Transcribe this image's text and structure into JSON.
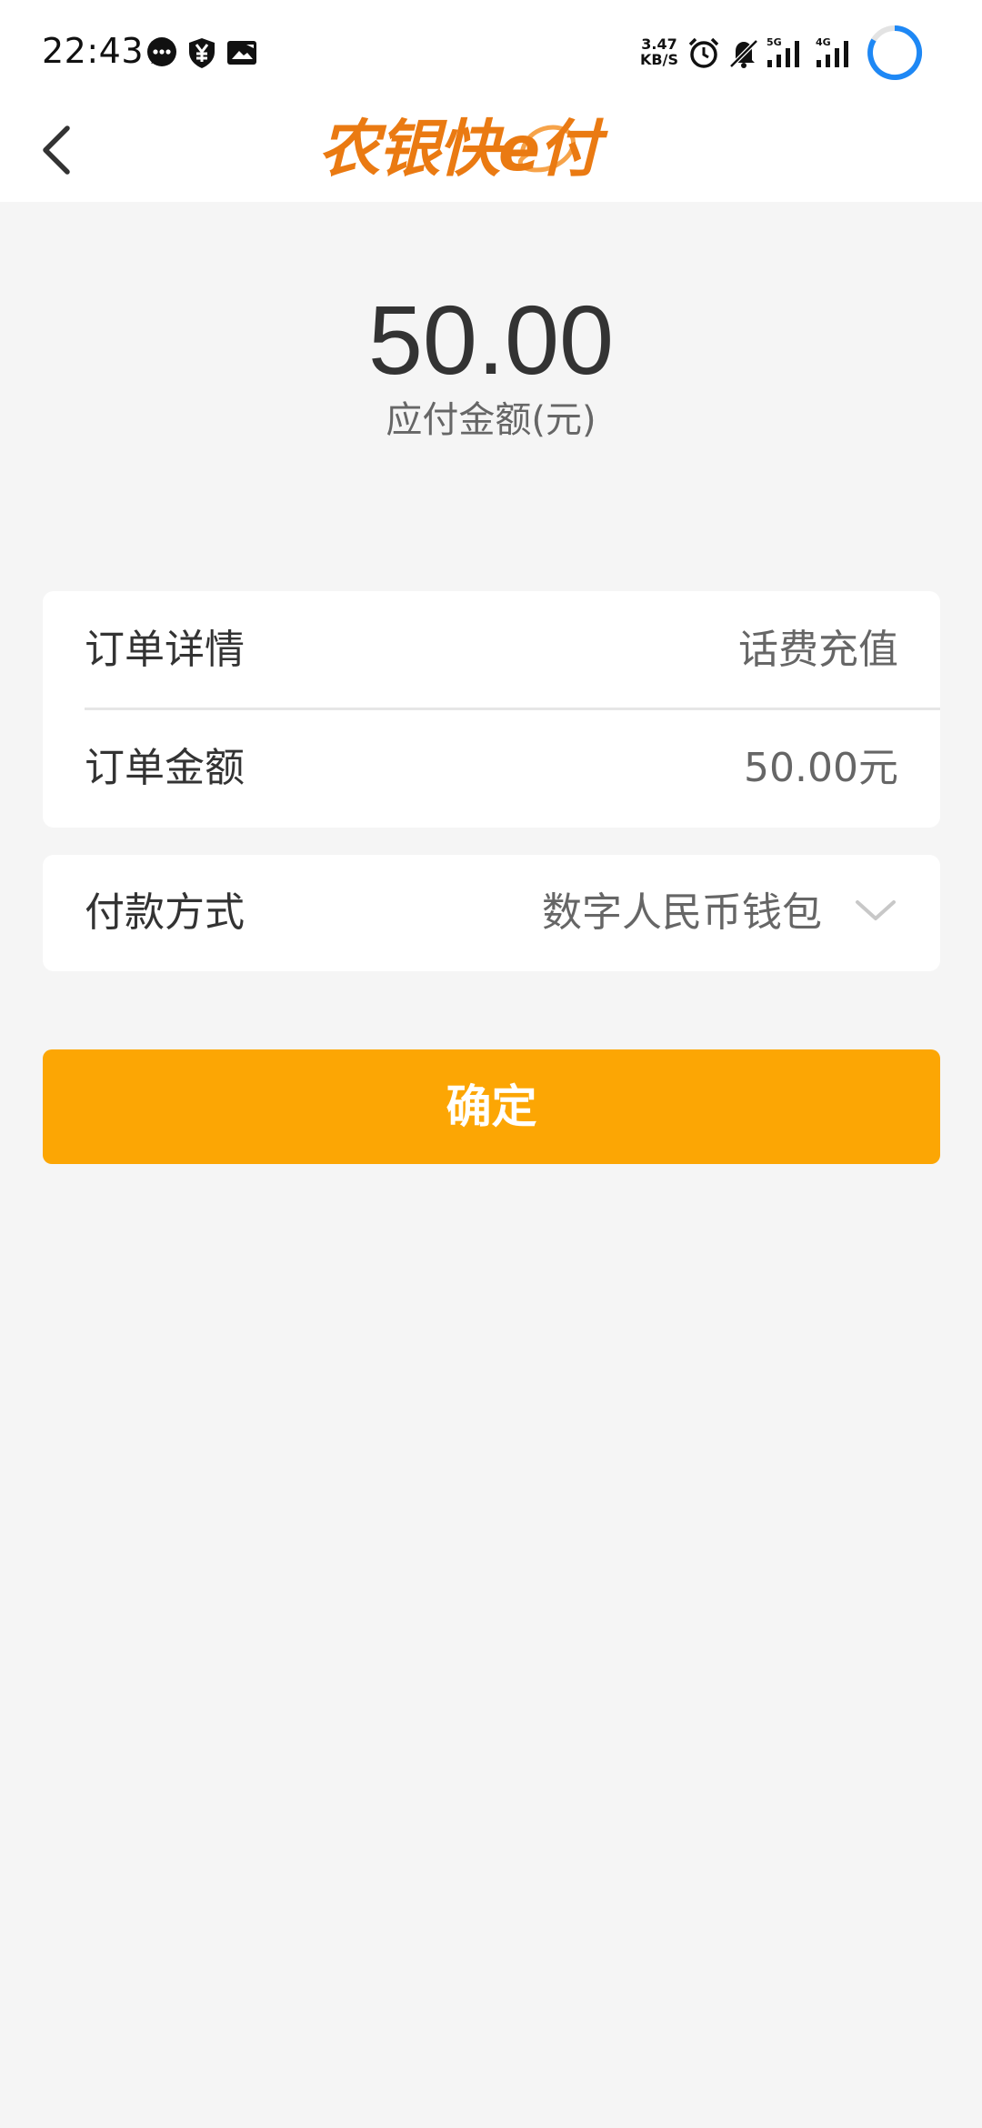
{
  "status_bar": {
    "time": "22:43",
    "net_speed_value": "3.47",
    "net_speed_unit": "KB/S",
    "signal_5g_label": "5G",
    "signal_4g_label": "4G",
    "icons": [
      "message-bubble-icon",
      "yuan-shield-icon",
      "image-notification-icon",
      "alarm-clock-icon",
      "mute-bell-icon",
      "signal-5g-icon",
      "signal-4g-icon",
      "loading-ring-icon"
    ]
  },
  "header": {
    "logo_text": "农银快e付",
    "back_icon": "chevron-left-icon"
  },
  "payment": {
    "amount": "50.00",
    "amount_label": "应付金额(元)"
  },
  "order": {
    "detail_label": "订单详情",
    "detail_value": "话费充值",
    "amount_label": "订单金额",
    "amount_value": "50.00元"
  },
  "method": {
    "label": "付款方式",
    "value": "数字人民币钱包",
    "dropdown_icon": "chevron-down-icon"
  },
  "actions": {
    "confirm_label": "确定"
  },
  "colors": {
    "brand_orange": "#ea7a12",
    "button_orange": "#fca604",
    "page_background": "#f5f5f5",
    "loading_blue": "#1e88f5"
  }
}
